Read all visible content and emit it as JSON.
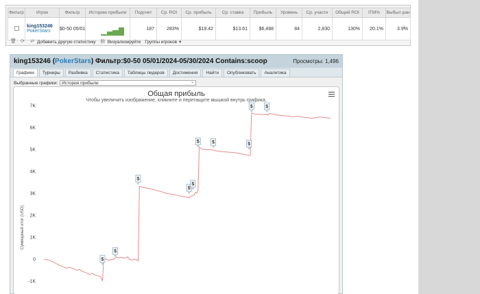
{
  "stats": {
    "headers": [
      "Фильтр",
      "Игрок",
      "Фильтр",
      "Историю прибыли",
      "Подсчет",
      "Ср. ROI",
      "Ср. прибыль",
      "Ср. ставка",
      "Прибыль",
      "Уровень",
      "Ср. участн",
      "Общий ROI",
      "ITM%",
      "Выбыл ран"
    ],
    "row": {
      "player": "king153246",
      "site": "PokerStars",
      "filter": "$0-50 05/01/2... 05/30/202... Contains:s",
      "count": "187",
      "avg_roi": "283%",
      "avg_profit": "$19.42",
      "avg_stake": "$13.61",
      "profit": "$6,488",
      "level": "84",
      "avg_entrants": "2,830",
      "total_roi": "130%",
      "itm": "20.1%",
      "early_out": "3.9%"
    },
    "toolbar": {
      "add_stat": "Добавить другую статистику",
      "visualize": "Визуализируйте",
      "groups": "Группы игроков"
    }
  },
  "panel": {
    "player": "king153246",
    "site": "PokerStars",
    "filter_text": "Фильтр:$0-50 05/01/2024-05/30/2024 Contains:scoop",
    "views_label": "Просмотры: 1,496",
    "tabs": [
      "Графики",
      "Турниры",
      "Разбивка",
      "Статистика",
      "Таблицы лидеров",
      "Достижения",
      "Найти",
      "Опубликовать",
      "Аналитика"
    ],
    "selector_label": "Выбранные графики:",
    "selector_value": "История прибыли"
  },
  "chart_data": {
    "type": "line",
    "title": "Общая прибыль",
    "subtitle": "Чтобы увеличить изображение, кликните и перетащите мышкой внутрь графика.",
    "ylabel": "Суммарный итог (USD)",
    "ylim": [
      -1000,
      7500
    ],
    "yticks": [
      "-1K",
      "0",
      "1K",
      "2K",
      "3K",
      "4K",
      "5K",
      "6K",
      "7K"
    ],
    "ytick_values": [
      -1000,
      0,
      1000,
      2000,
      3000,
      4000,
      5000,
      6000,
      7000
    ],
    "series": [
      {
        "color": "#e88a8a",
        "points": [
          [
            0,
            0
          ],
          [
            4,
            -50
          ],
          [
            8,
            -150
          ],
          [
            12,
            -280
          ],
          [
            15,
            -350
          ],
          [
            18,
            -420
          ],
          [
            20,
            -380
          ],
          [
            23,
            -430
          ],
          [
            26,
            -520
          ],
          [
            28,
            -470
          ],
          [
            30,
            -560
          ],
          [
            32,
            -600
          ],
          [
            34,
            -650
          ],
          [
            36,
            -700
          ],
          [
            38,
            -650
          ],
          [
            40,
            -720
          ],
          [
            42,
            -760
          ],
          [
            44,
            -790
          ],
          [
            45,
            -860
          ],
          [
            46,
            -1000
          ],
          [
            47,
            -5
          ],
          [
            49,
            0
          ],
          [
            51,
            -60
          ],
          [
            53,
            -20
          ],
          [
            55,
            0
          ],
          [
            57,
            100
          ],
          [
            59,
            50
          ],
          [
            61,
            80
          ],
          [
            63,
            30
          ],
          [
            65,
            80
          ],
          [
            66,
            100
          ],
          [
            67,
            -10
          ],
          [
            69,
            -50
          ],
          [
            71,
            0
          ],
          [
            73,
            -40
          ],
          [
            74,
            -80
          ],
          [
            75,
            3310
          ],
          [
            78,
            3270
          ],
          [
            81,
            3230
          ],
          [
            84,
            3200
          ],
          [
            87,
            3150
          ],
          [
            90,
            3100
          ],
          [
            93,
            3060
          ],
          [
            96,
            3000
          ],
          [
            99,
            2970
          ],
          [
            102,
            2940
          ],
          [
            105,
            2900
          ],
          [
            108,
            2860
          ],
          [
            111,
            2840
          ],
          [
            113,
            2800
          ],
          [
            114,
            2790
          ],
          [
            115,
            2870
          ],
          [
            117,
            2890
          ],
          [
            118,
            2920
          ],
          [
            119,
            3050
          ],
          [
            120,
            3000
          ],
          [
            121,
            3120
          ],
          [
            122,
            5100
          ],
          [
            125,
            5000
          ],
          [
            128,
            4980
          ],
          [
            131,
            5000
          ],
          [
            134,
            4950
          ],
          [
            137,
            4920
          ],
          [
            140,
            4900
          ],
          [
            143,
            4880
          ],
          [
            146,
            4870
          ],
          [
            149,
            4860
          ],
          [
            152,
            4830
          ],
          [
            154,
            4800
          ],
          [
            156,
            4780
          ],
          [
            158,
            4760
          ],
          [
            160,
            4740
          ],
          [
            161,
            4720
          ],
          [
            162,
            4750
          ],
          [
            163,
            6660
          ],
          [
            166,
            6600
          ],
          [
            169,
            6600
          ],
          [
            172,
            6580
          ],
          [
            175,
            6590
          ],
          [
            176,
            6560
          ],
          [
            177,
            6640
          ],
          [
            180,
            6600
          ],
          [
            183,
            6570
          ],
          [
            186,
            6550
          ],
          [
            189,
            6530
          ],
          [
            192,
            6520
          ],
          [
            195,
            6480
          ],
          [
            198,
            6510
          ],
          [
            201,
            6500
          ],
          [
            204,
            6460
          ],
          [
            207,
            6450
          ],
          [
            210,
            6420
          ],
          [
            213,
            6440
          ],
          [
            216,
            6480
          ],
          [
            219,
            6460
          ],
          [
            222,
            6440
          ],
          [
            225,
            6420
          ]
        ]
      }
    ],
    "markers": [
      {
        "x": 46,
        "y": -180,
        "label": "$"
      },
      {
        "x": 56,
        "y": 180,
        "label": "$"
      },
      {
        "x": 74,
        "y": 3480,
        "label": "$"
      },
      {
        "x": 114,
        "y": 3060,
        "label": "$"
      },
      {
        "x": 117,
        "y": 3250,
        "label": "$"
      },
      {
        "x": 121,
        "y": 5180,
        "label": "$"
      },
      {
        "x": 133,
        "y": 5150,
        "label": "$"
      },
      {
        "x": 161,
        "y": 5080,
        "label": "$"
      },
      {
        "x": 163,
        "y": 6780,
        "label": "$"
      },
      {
        "x": 175,
        "y": 6780,
        "label": "$"
      }
    ]
  }
}
